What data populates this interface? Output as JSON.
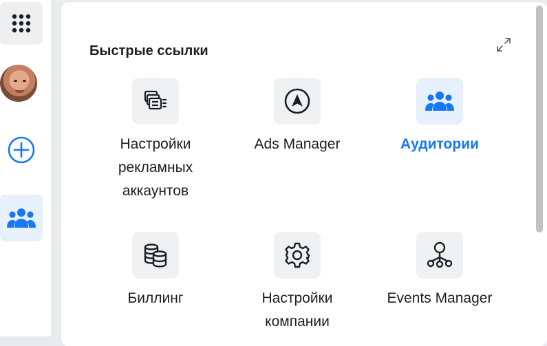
{
  "rail": {
    "items": [
      {
        "icon": "grid-dots-icon",
        "active": false
      },
      {
        "icon": "user-avatar",
        "active": false
      },
      {
        "icon": "plus-circle-icon",
        "active": false
      },
      {
        "icon": "audiences-icon",
        "active": true
      }
    ]
  },
  "quick_links": {
    "title": "Быстрые ссылки",
    "expand_icon": "expand-icon",
    "items": [
      {
        "label": "Настройки\nрекламных\nаккаунтов",
        "icon": "ad-account-settings-icon",
        "active": false
      },
      {
        "label": "Ads Manager",
        "icon": "ads-manager-icon",
        "active": false
      },
      {
        "label": "Аудитории",
        "icon": "audiences-icon",
        "active": true
      },
      {
        "label": "Биллинг",
        "icon": "billing-coins-icon",
        "active": false
      },
      {
        "label": "Настройки\nкомпании",
        "icon": "gear-icon",
        "active": false
      },
      {
        "label": "Events Manager",
        "icon": "events-manager-icon",
        "active": false
      }
    ]
  },
  "colors": {
    "accent": "#1877f2",
    "active_bg": "#e7f0fd",
    "tile_bg": "#f0f1f3",
    "text": "#1c1e21"
  }
}
